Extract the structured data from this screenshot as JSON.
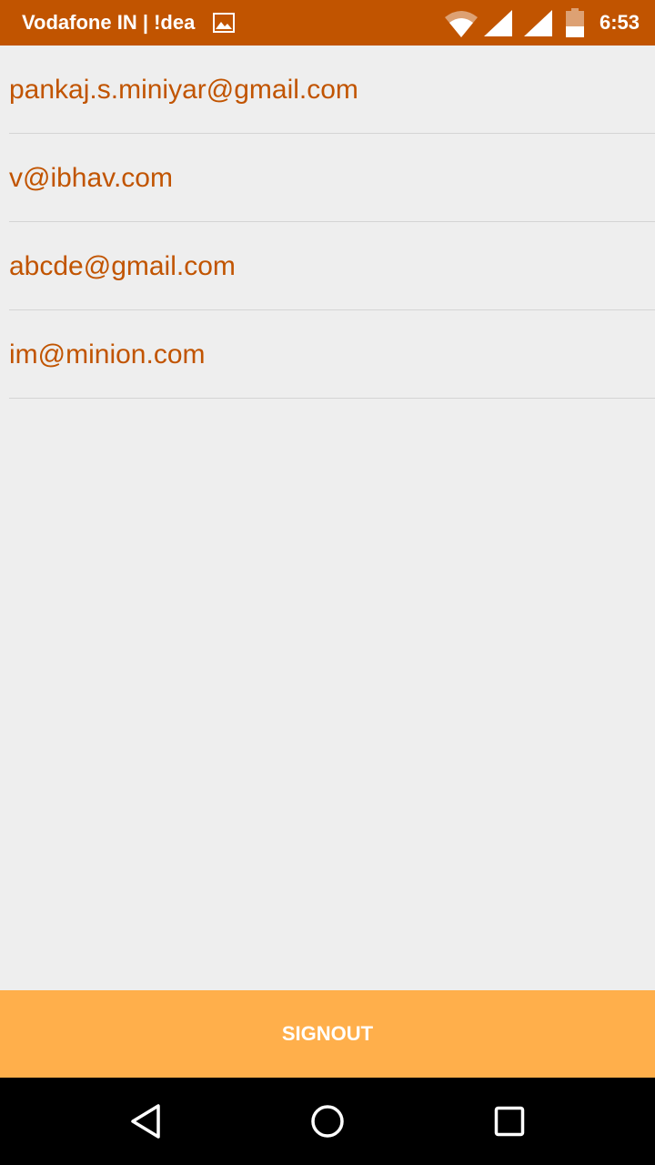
{
  "status_bar": {
    "carrier": "Vodafone IN | !dea",
    "time": "6:53",
    "background": "#c15400",
    "icons": [
      "gallery-icon",
      "wifi-icon",
      "signal-icon",
      "signal-icon",
      "battery-icon"
    ]
  },
  "emails": [
    "pankaj.s.miniyar@gmail.com",
    "v@ibhav.com",
    "abcde@gmail.com",
    "im@minion.com"
  ],
  "signout": {
    "label": "SIGNOUT",
    "background": "#ffaf4b"
  },
  "colors": {
    "accent_text": "#c15400",
    "background": "#eeeeee",
    "divider": "#d4d4d4"
  },
  "nav_bar": {
    "icons": [
      "back-icon",
      "home-icon",
      "recents-icon"
    ]
  }
}
